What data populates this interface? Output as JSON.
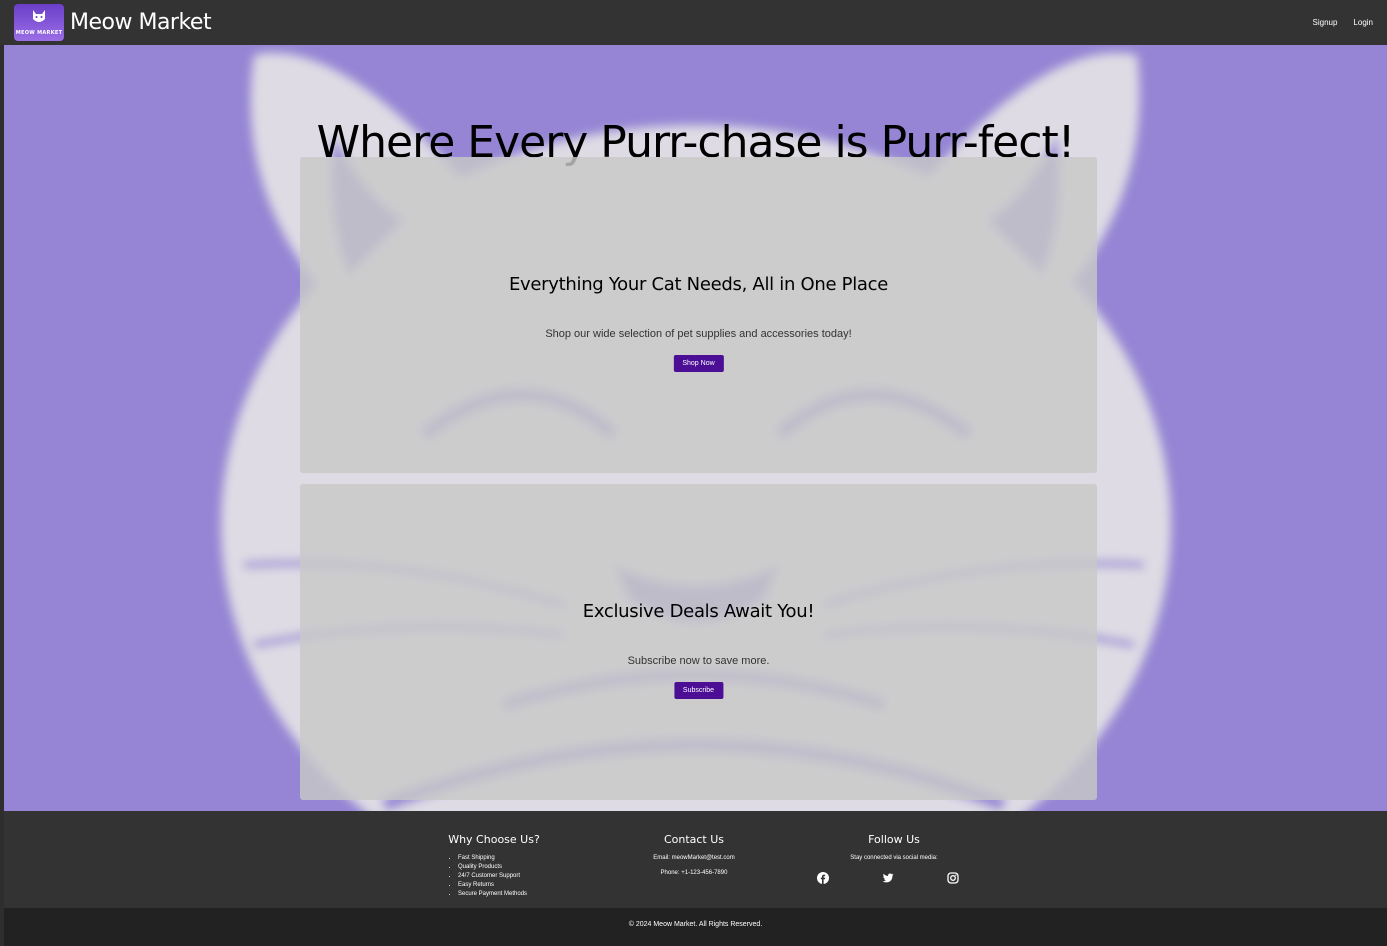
{
  "navbar": {
    "logo_text": "MEOW MARKET",
    "brand": "Meow Market",
    "links": [
      "Signup",
      "Login"
    ]
  },
  "hero": {
    "headline": "Where Every Purr-chase is Purr-fect!"
  },
  "cards": [
    {
      "title": "Everything Your Cat Needs, All in One Place",
      "text": "Shop our wide selection of pet supplies and accessories today!",
      "button": "Shop Now"
    },
    {
      "title": "Exclusive Deals Await You!",
      "text": "Subscribe now to save more.",
      "button": "Subscribe"
    }
  ],
  "footer": {
    "why": {
      "title": "Why Choose Us?",
      "items": [
        "Fast Shipping",
        "Quality Products",
        "24/7 Customer Support",
        "Easy Returns",
        "Secure Payment Methods"
      ]
    },
    "contact": {
      "title": "Contact Us",
      "email": "Email: meowMarket@test.com",
      "phone": "Phone: +1-123-456-7890"
    },
    "follow": {
      "title": "Follow Us",
      "text": "Stay connected via social media:",
      "icons": [
        "facebook-icon",
        "twitter-icon",
        "instagram-icon"
      ]
    },
    "copyright": "© 2024 Meow Market. All Rights Reserved."
  },
  "colors": {
    "navbar": "#333333",
    "hero_purple": "#9a87d6",
    "button": "#4b0e95",
    "footer": "#333333"
  }
}
